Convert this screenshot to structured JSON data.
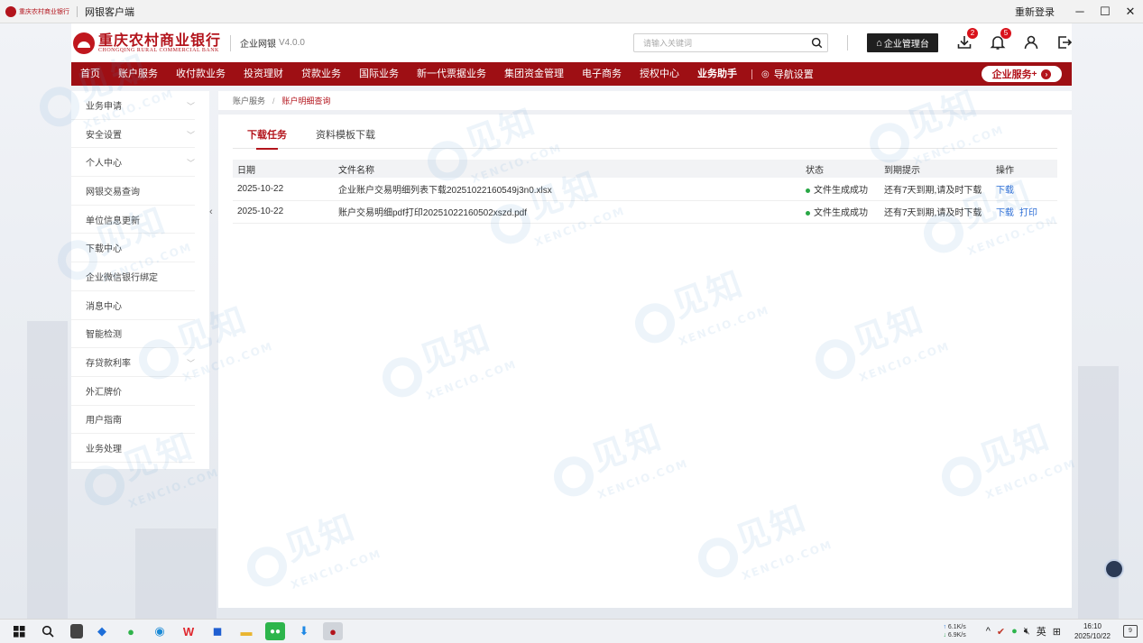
{
  "window": {
    "app_logo_text": "重庆农村商业银行",
    "title": "网银客户端",
    "relogin": "重新登录",
    "min": "─",
    "max": "☐",
    "close": "✕"
  },
  "header": {
    "brand_cn": "重庆农村商业银行",
    "brand_en": "CHONGQING RURAL COMMERCIAL BANK",
    "system_name": "企业网银",
    "version": "V4.0.0",
    "search_placeholder": "请输入关键词",
    "manager_button": "企业管理台",
    "download_badge": "2",
    "notify_badge": "5"
  },
  "nav": {
    "items": [
      "首页",
      "账户服务",
      "收付款业务",
      "投资理财",
      "贷款业务",
      "国际业务",
      "新一代票据业务",
      "集团资金管理",
      "电子商务",
      "授权中心",
      "业务助手"
    ],
    "setting_label": "导航设置",
    "service_button": "企业服务",
    "service_plus": "+"
  },
  "sidebar": {
    "items": [
      {
        "label": "业务申请",
        "chevron": true
      },
      {
        "label": "安全设置",
        "chevron": true
      },
      {
        "label": "个人中心",
        "chevron": true
      },
      {
        "label": "网银交易查询",
        "chevron": false
      },
      {
        "label": "单位信息更新",
        "chevron": false
      },
      {
        "label": "下载中心",
        "chevron": false
      },
      {
        "label": "企业微信银行绑定",
        "chevron": false
      },
      {
        "label": "消息中心",
        "chevron": false
      },
      {
        "label": "智能检测",
        "chevron": false
      },
      {
        "label": "存贷款利率",
        "chevron": true
      },
      {
        "label": "外汇牌价",
        "chevron": false
      },
      {
        "label": "用户指南",
        "chevron": false
      },
      {
        "label": "业务处理",
        "chevron": false
      }
    ]
  },
  "breadcrumb": {
    "parent": "账户服务",
    "separator": "/",
    "current": "账户明细查询"
  },
  "tabs": [
    {
      "label": "下载任务",
      "active": true
    },
    {
      "label": "资料模板下载",
      "active": false
    }
  ],
  "table": {
    "headers": [
      "日期",
      "文件名称",
      "状态",
      "到期提示",
      "操作"
    ],
    "rows": [
      {
        "date": "2025-10-22",
        "file": "企业账户交易明细列表下载20251022160549j3n0.xlsx",
        "status": "文件生成成功",
        "expiry": "还有7天到期,请及时下载",
        "ops": [
          "下载"
        ]
      },
      {
        "date": "2025-10-22",
        "file": "账户交易明细pdf打印20251022160502xszd.pdf",
        "status": "文件生成成功",
        "expiry": "还有7天到期,请及时下载",
        "ops": [
          "下载",
          "打印"
        ]
      }
    ]
  },
  "watermark": {
    "brand": "见知",
    "domain": "XENCIO.COM"
  },
  "taskbar": {
    "net_up": "6.1K/s",
    "net_down": "6.9K/s",
    "ime": "英",
    "time": "16:10",
    "date": "2025/10/22",
    "notif_count": "9"
  },
  "colors": {
    "brand_red": "#b3141c",
    "nav_red": "#9e0f14",
    "link_blue": "#2f6fd6",
    "status_green": "#28a745"
  }
}
